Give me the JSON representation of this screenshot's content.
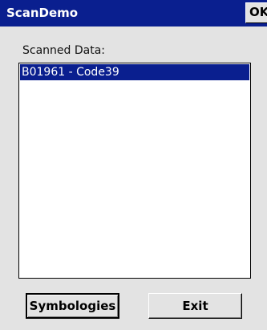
{
  "window": {
    "title": "ScanDemo",
    "ok_label": "OK"
  },
  "main": {
    "list_label": "Scanned Data:",
    "scanned_items": [
      {
        "text": "B01961 - Code39",
        "selected": true
      }
    ]
  },
  "buttons": {
    "symbologies_label": "Symbologies",
    "exit_label": "Exit"
  },
  "colors": {
    "titlebar": "#0a1f8f",
    "selection": "#0a1f8f",
    "background": "#e3e3e3"
  }
}
